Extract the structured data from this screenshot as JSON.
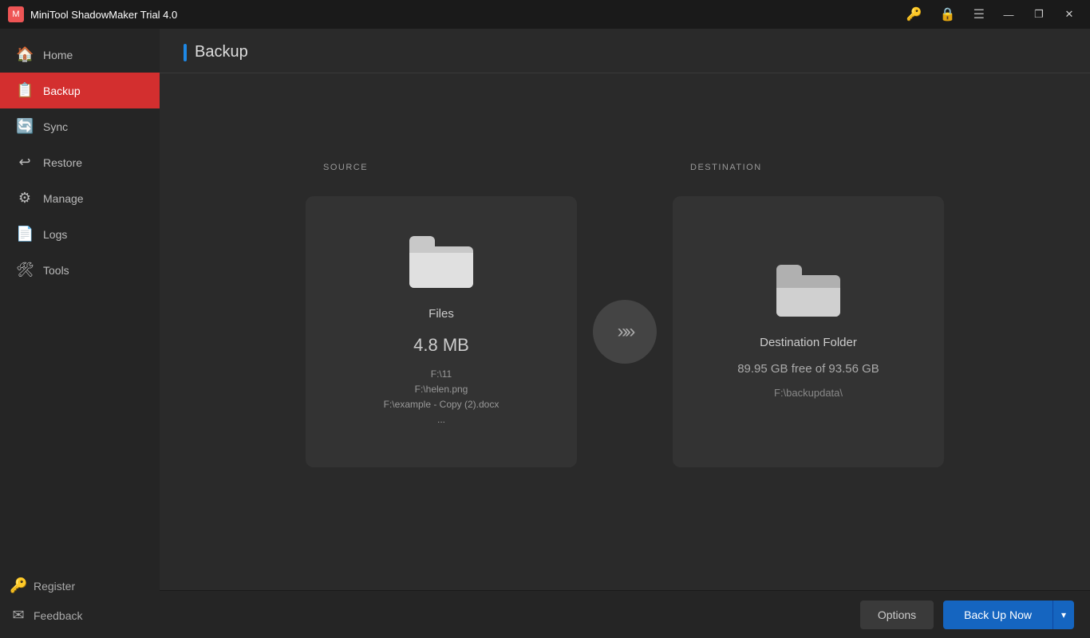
{
  "titlebar": {
    "app_name": "MiniTool ShadowMaker Trial 4.0",
    "icons": {
      "key": "🔑",
      "lock": "🔒",
      "menu": "☰",
      "minimize": "—",
      "maximize": "❐",
      "close": "✕"
    }
  },
  "sidebar": {
    "items": [
      {
        "id": "home",
        "label": "Home",
        "icon": "🏠"
      },
      {
        "id": "backup",
        "label": "Backup",
        "icon": "📋",
        "active": true
      },
      {
        "id": "sync",
        "label": "Sync",
        "icon": "🔄"
      },
      {
        "id": "restore",
        "label": "Restore",
        "icon": "⚙"
      },
      {
        "id": "manage",
        "label": "Manage",
        "icon": "⚙"
      },
      {
        "id": "logs",
        "label": "Logs",
        "icon": "📄"
      },
      {
        "id": "tools",
        "label": "Tools",
        "icon": "🛠"
      }
    ],
    "bottom_items": [
      {
        "id": "register",
        "label": "Register",
        "icon": "🔑"
      },
      {
        "id": "feedback",
        "label": "Feedback",
        "icon": "✉"
      }
    ]
  },
  "page": {
    "title": "Backup"
  },
  "source_card": {
    "label": "SOURCE",
    "name": "Files",
    "size": "4.8 MB",
    "files": [
      "F:\\11",
      "F:\\helen.png",
      "F:\\example - Copy (2).docx",
      "..."
    ]
  },
  "destination_card": {
    "label": "DESTINATION",
    "name": "Destination Folder",
    "free_space": "89.95 GB free of 93.56 GB",
    "path": "F:\\backupdata\\"
  },
  "bottom_bar": {
    "options_label": "Options",
    "backup_now_label": "Back Up Now",
    "dropdown_arrow": "▾"
  }
}
